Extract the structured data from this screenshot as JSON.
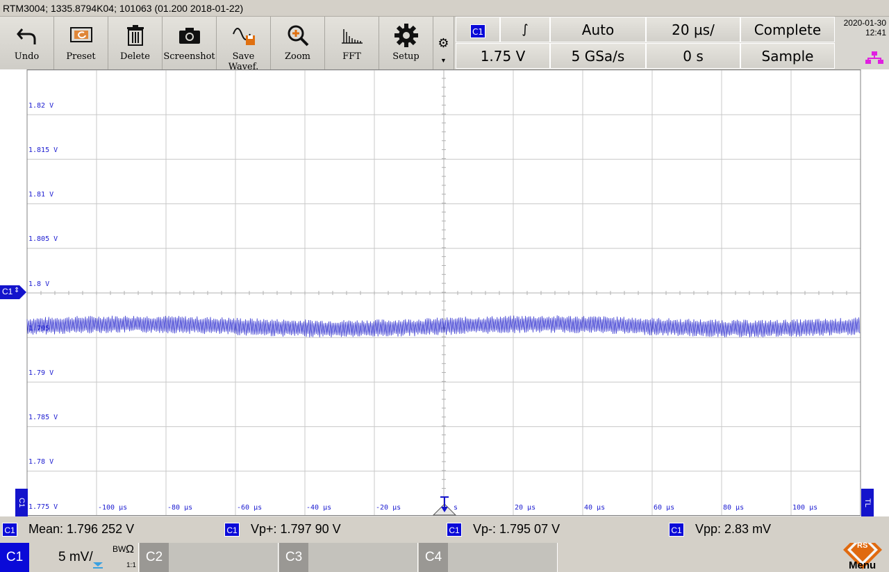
{
  "title": "RTM3004; 1335.8794K04; 101063 (01.200 2018-01-22)",
  "toolbar": [
    {
      "label": "Undo",
      "icon": "undo-icon"
    },
    {
      "label": "Preset",
      "icon": "preset-icon"
    },
    {
      "label": "Delete",
      "icon": "trash-icon"
    },
    {
      "label": "Screenshot",
      "icon": "camera-icon"
    },
    {
      "label": "Save Wavef.",
      "icon": "save-waveform-icon"
    },
    {
      "label": "Zoom",
      "icon": "zoom-icon"
    },
    {
      "label": "FFT",
      "icon": "fft-icon"
    },
    {
      "label": "Setup",
      "icon": "gear-icon"
    }
  ],
  "trigger": {
    "source": "C1",
    "slope": "∫",
    "level": "1.75 V",
    "mode": "Auto",
    "timebase": "20 µs/",
    "samplerate": "5 GSa/s",
    "position": "0 s",
    "acq_state": "Complete",
    "acq_mode": "Sample"
  },
  "datetime": {
    "date": "2020-01-30",
    "time": "12:41"
  },
  "axes": {
    "y_labels": [
      "1.82 V",
      "1.815 V",
      "1.81 V",
      "1.805 V",
      "1.8 V",
      "1.795",
      "1.79 V",
      "1.785 V",
      "1.78 V",
      "1.775 V"
    ],
    "x_labels": [
      "-100 µs",
      "-80 µs",
      "-60 µs",
      "-40 µs",
      "-20 µs",
      "s",
      "20 µs",
      "40 µs",
      "60 µs",
      "80 µs",
      "100 µs"
    ]
  },
  "markers": {
    "channel": "C1",
    "left_tab": "C1",
    "right_tab": "TL"
  },
  "measurements": [
    {
      "ch": "C1",
      "text": "Mean: 1.796 252 V"
    },
    {
      "ch": "C1",
      "text": "Vp+: 1.797 90 V"
    },
    {
      "ch": "C1",
      "text": "Vp-: 1.795 07 V"
    },
    {
      "ch": "C1",
      "text": "Vpp: 2.83 mV"
    }
  ],
  "channels": [
    {
      "name": "C1",
      "scale": "5 mV/",
      "bw": "BW",
      "coupling": "Ω",
      "ratio": "1:1",
      "active": true
    },
    {
      "name": "C2",
      "active": false
    },
    {
      "name": "C3",
      "active": false
    },
    {
      "name": "C4",
      "active": false
    }
  ],
  "menu_label": "Menu",
  "logo_text": "RS",
  "colors": {
    "trace": "#2222cc",
    "badge": "#0a0ad8",
    "logo": "#e06a10"
  }
}
